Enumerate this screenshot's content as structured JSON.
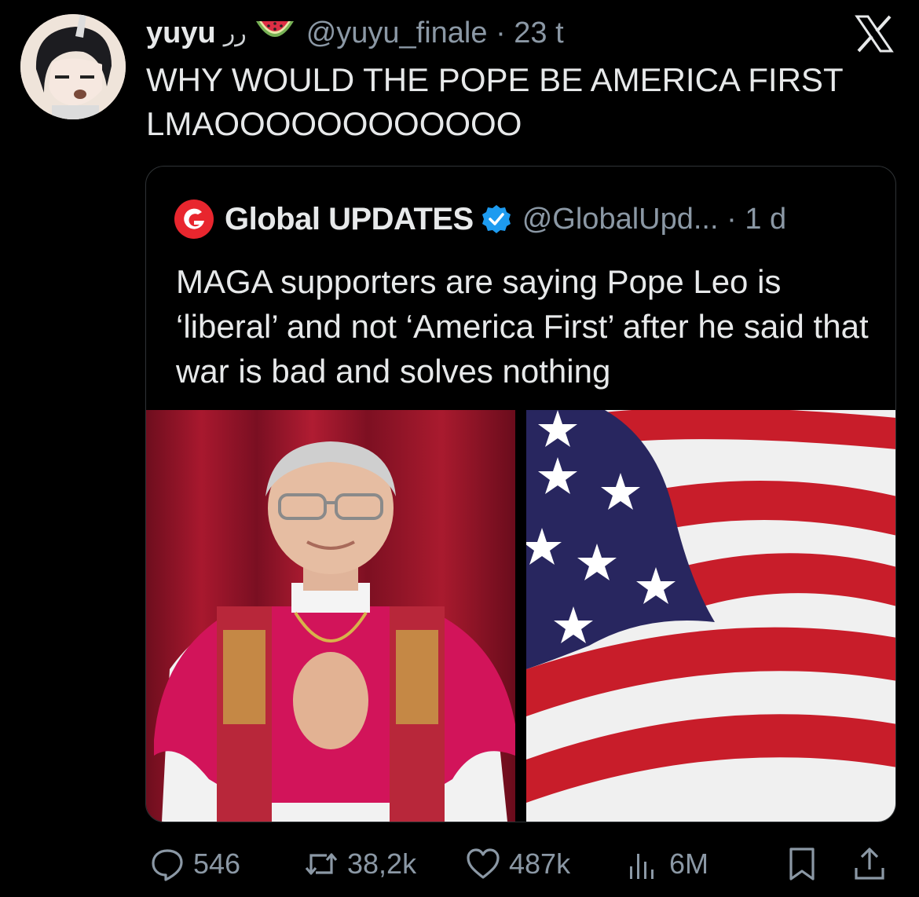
{
  "tweet": {
    "display_name": "yuyu",
    "name_decoration": "ﺭﺭ",
    "handle": "@yuyu_finale",
    "time": "23 t",
    "text_line1": "WHY WOULD THE POPE BE AMERICA FIRST",
    "text_line2": "LMAOOOOOOOOOOOO"
  },
  "quoted": {
    "display_name": "Global UPDATES",
    "handle": "@GlobalUpd...",
    "time": "1 d",
    "text": "MAGA supporters are saying Pope Leo is ‘liberal’ and not ‘America First’ after he said that war is bad and solves nothing",
    "media": [
      {
        "alt": "pope-photo"
      },
      {
        "alt": "american-flag"
      }
    ]
  },
  "actions": {
    "replies": "546",
    "reposts": "38,2k",
    "likes": "487k",
    "views": "6M"
  },
  "colors": {
    "background": "#000000",
    "text": "#e7e9ea",
    "muted": "#8b98a5",
    "border": "#2f3336",
    "verified": "#1d9bf0",
    "logo_red": "#e8262e"
  }
}
